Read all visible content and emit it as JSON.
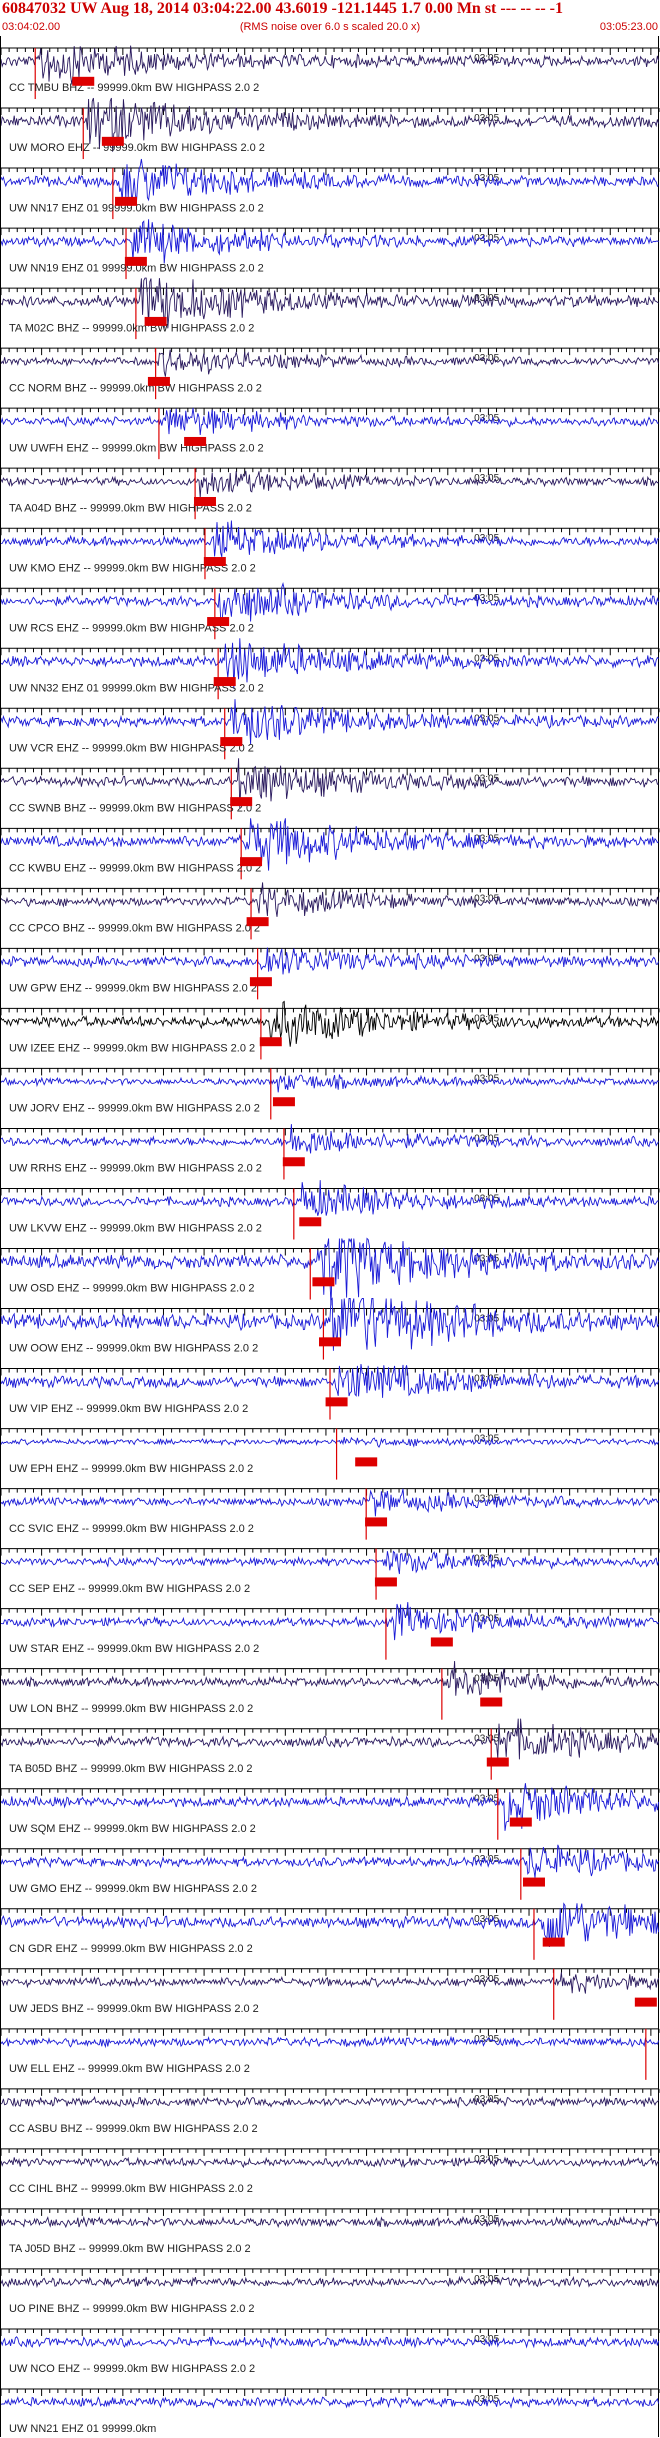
{
  "header": {
    "title": "60847032 UW Aug 18, 2014 03:04:22.00   43.6019 -121.1445  1.7 0.00 Mn st --- -- --   -1",
    "start_time": "03:04:02.00",
    "rms_note": "(RMS noise over 6.0 s scaled 20.0 x)",
    "end_time": "03:05:23.00"
  },
  "chart_data": {
    "type": "line",
    "title": "60847032 UW Aug 18, 2014 03:04:22.00   43.6019 -121.1445  1.7 0.00 Mn st --- -- --   -1",
    "x_start": "03:04:02.00",
    "x_end": "03:05:23.00",
    "x_tick_label": "03:05",
    "minute_tick_seconds": 58,
    "total_seconds": 81,
    "colors": {
      "blue": "#1a1ad6",
      "dark": "#2a1a5e",
      "black": "#000000",
      "pick": "#dd0000"
    },
    "traces": [
      {
        "label": "CC TMBU BHZ -- 99999.0km BW  HIGHPASS  2.0  2",
        "color": "dark",
        "pick": 0.052,
        "event": 0.06,
        "amp": 0.5,
        "burst": 2
      },
      {
        "label": "UW MORO EHZ -- 99999.0km BW  HIGHPASS  2.0  2",
        "color": "dark",
        "pick": 0.125,
        "event": 0.13,
        "amp": 0.55,
        "burst": 2.5
      },
      {
        "label": "UW NN17 EHZ 01 99999.0km BW  HIGHPASS  2.0  2",
        "color": "blue",
        "pick": 0.17,
        "event": 0.18,
        "amp": 0.45,
        "burst": 2.2
      },
      {
        "label": "UW NN19 EHZ 01 99999.0km BW  HIGHPASS  2.0  2",
        "color": "blue",
        "pick": 0.19,
        "event": 0.2,
        "amp": 0.4,
        "burst": 2
      },
      {
        "label": "TA M02C BHZ -- 99999.0km BW  HIGHPASS  2.0  2",
        "color": "dark",
        "pick": 0.205,
        "event": 0.21,
        "amp": 0.5,
        "burst": 2.6
      },
      {
        "label": "CC NORM BHZ -- 99999.0km BW  HIGHPASS  2.0  2",
        "color": "dark",
        "pick": 0.235,
        "event": 0.24,
        "amp": 0.25,
        "burst": 1.5
      },
      {
        "label": "UW UWFH EHZ -- 99999.0km BW  HIGHPASS  2.0  2",
        "color": "blue",
        "pick": 0.24,
        "event": 0.25,
        "amp": 0.3,
        "burst": 1.5
      },
      {
        "label": "TA A04D BHZ -- 99999.0km BW  HIGHPASS  2.0  2",
        "color": "dark",
        "pick": 0.295,
        "event": 0.3,
        "amp": 0.25,
        "burst": 1.6
      },
      {
        "label": "UW KMO EHZ -- 99999.0km BW  HIGHPASS  2.0  2",
        "color": "blue",
        "pick": 0.31,
        "event": 0.32,
        "amp": 0.35,
        "burst": 1.8
      },
      {
        "label": "UW RCS EHZ -- 99999.0km BW  HIGHPASS  2.0  2",
        "color": "blue",
        "pick": 0.325,
        "event": 0.33,
        "amp": 0.4,
        "burst": 2
      },
      {
        "label": "UW NN32 EHZ 01 99999.0km BW  HIGHPASS  2.0  2",
        "color": "blue",
        "pick": 0.33,
        "event": 0.34,
        "amp": 0.45,
        "burst": 2.2
      },
      {
        "label": "UW VCR EHZ -- 99999.0km BW  HIGHPASS  2.0  2",
        "color": "blue",
        "pick": 0.34,
        "event": 0.35,
        "amp": 0.45,
        "burst": 2
      },
      {
        "label": "CC SWNB BHZ -- 99999.0km BW  HIGHPASS  2.0  2",
        "color": "dark",
        "pick": 0.35,
        "event": 0.36,
        "amp": 0.4,
        "burst": 2.2
      },
      {
        "label": "CC KWBU EHZ -- 99999.0km BW  HIGHPASS  2.0  2",
        "color": "blue",
        "pick": 0.365,
        "event": 0.37,
        "amp": 0.5,
        "burst": 2.5
      },
      {
        "label": "CC CPCO BHZ -- 99999.0km BW  HIGHPASS  2.0  2",
        "color": "dark",
        "pick": 0.38,
        "event": 0.39,
        "amp": 0.3,
        "burst": 1.6
      },
      {
        "label": "UW GPW EHZ -- 99999.0km BW  HIGHPASS  2.0  2",
        "color": "blue",
        "pick": 0.39,
        "event": 0.395,
        "amp": 0.4,
        "burst": 1.5
      },
      {
        "label": "UW IZEE EHZ -- 99999.0km BW  HIGHPASS  2.0  2",
        "color": "black",
        "pick": 0.395,
        "event": 0.405,
        "amp": 0.5,
        "burst": 2
      },
      {
        "label": "UW JORV EHZ -- 99999.0km BW  HIGHPASS  2.0  2",
        "color": "blue",
        "pick": 0.41,
        "event": 0.42,
        "amp": 0.15,
        "burst": 1
      },
      {
        "label": "UW RRHS EHZ -- 99999.0km BW  HIGHPASS  2.0  2",
        "color": "blue",
        "pick": 0.43,
        "event": 0.44,
        "amp": 0.3,
        "burst": 1.5
      },
      {
        "label": "UW LKVW EHZ -- 99999.0km BW  HIGHPASS  2.0  2",
        "color": "blue",
        "pick": 0.445,
        "event": 0.455,
        "amp": 0.35,
        "burst": 1.8
      },
      {
        "label": "UW OSD EHZ -- 99999.0km BW  HIGHPASS  2.0  2",
        "color": "blue",
        "pick": 0.47,
        "event": 0.48,
        "amp": 0.7,
        "burst": 3
      },
      {
        "label": "UW OOW EHZ -- 99999.0km BW  HIGHPASS  2.0  2",
        "color": "blue",
        "pick": 0.49,
        "event": 0.5,
        "amp": 0.8,
        "burst": 3
      },
      {
        "label": "UW VIP EHZ -- 99999.0km BW  HIGHPASS  2.0  2",
        "color": "blue",
        "pick": 0.5,
        "event": 0.51,
        "amp": 0.5,
        "burst": 2
      },
      {
        "label": "UW EPH EHZ -- 99999.0km BW  HIGHPASS  2.0  2",
        "color": "blue",
        "pick": 0.51,
        "event": 0.52,
        "amp": 0.05,
        "burst": 0.5
      },
      {
        "label": "CC SVIC EHZ -- 99999.0km BW  HIGHPASS  2.0  2",
        "color": "blue",
        "pick": 0.555,
        "event": 0.56,
        "amp": 0.25,
        "burst": 1.3
      },
      {
        "label": "CC SEP EHZ -- 99999.0km BW  HIGHPASS  2.0  2",
        "color": "blue",
        "pick": 0.57,
        "event": 0.58,
        "amp": 0.25,
        "burst": 1.3
      },
      {
        "label": "UW STAR EHZ -- 99999.0km BW  HIGHPASS  2.0  2",
        "color": "blue",
        "pick": 0.585,
        "event": 0.595,
        "amp": 0.3,
        "burst": 1.8
      },
      {
        "label": "UW LON BHZ -- 99999.0km BW  HIGHPASS  2.0  2",
        "color": "dark",
        "pick": 0.67,
        "event": 0.68,
        "amp": 0.3,
        "burst": 1.6
      },
      {
        "label": "TA B05D BHZ -- 99999.0km BW  HIGHPASS  2.0  2",
        "color": "dark",
        "pick": 0.745,
        "event": 0.755,
        "amp": 0.4,
        "burst": 2
      },
      {
        "label": "UW SQM EHZ -- 99999.0km BW  HIGHPASS  2.0  2",
        "color": "blue",
        "pick": 0.755,
        "event": 0.765,
        "amp": 0.4,
        "burst": 2.2
      },
      {
        "label": "UW GMO EHZ -- 99999.0km BW  HIGHPASS  2.0  2",
        "color": "blue",
        "pick": 0.79,
        "event": 0.8,
        "amp": 0.35,
        "burst": 1.6
      },
      {
        "label": "CN GDR EHZ -- 99999.0km BW  HIGHPASS  2.0  2",
        "color": "blue",
        "pick": 0.81,
        "event": 0.82,
        "amp": 0.5,
        "burst": 2.5
      },
      {
        "label": "UW JEDS BHZ -- 99999.0km BW  HIGHPASS  2.0  2",
        "color": "dark",
        "pick": 0.84,
        "event": 0.85,
        "amp": 0.3,
        "burst": 0.8
      },
      {
        "label": "UW ELL EHZ -- 99999.0km BW  HIGHPASS  2.0  2",
        "color": "blue",
        "pick": 0.98,
        "event": 0.99,
        "amp": 0.3,
        "burst": 0
      },
      {
        "label": "CC ASBU BHZ -- 99999.0km BW  HIGHPASS  2.0  2",
        "color": "dark",
        "pick": null,
        "event": null,
        "amp": 0.3,
        "burst": 0
      },
      {
        "label": "CC CIHL BHZ -- 99999.0km BW  HIGHPASS  2.0  2",
        "color": "dark",
        "pick": null,
        "event": null,
        "amp": 0.3,
        "burst": 0
      },
      {
        "label": "TA J05D BHZ -- 99999.0km BW  HIGHPASS  2.0  2",
        "color": "dark",
        "pick": null,
        "event": null,
        "amp": 0.3,
        "burst": 0
      },
      {
        "label": "UO PINE BHZ -- 99999.0km BW  HIGHPASS  2.0  2",
        "color": "dark",
        "pick": null,
        "event": null,
        "amp": 0.35,
        "burst": 0
      },
      {
        "label": "UW NCO EHZ -- 99999.0km BW  HIGHPASS  2.0  2",
        "color": "blue",
        "pick": null,
        "event": null,
        "amp": 0.35,
        "burst": 0
      },
      {
        "label": "UW NN21 EHZ 01 99999.0km",
        "color": "blue",
        "pick": null,
        "event": null,
        "amp": 0.35,
        "burst": 0
      }
    ]
  }
}
